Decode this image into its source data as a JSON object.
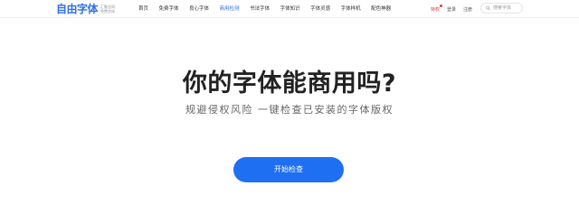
{
  "logo": {
    "text": "自由字体",
    "sub_line1": "汇聚全网",
    "sub_line2": "免费字体"
  },
  "nav": {
    "items": [
      {
        "label": "首页"
      },
      {
        "label": "免费字体"
      },
      {
        "label": "良心字体"
      },
      {
        "label": "商用检测",
        "active": true
      },
      {
        "label": "书法字体"
      },
      {
        "label": "字体知识"
      },
      {
        "label": "字体灵感"
      },
      {
        "label": "字体样机"
      },
      {
        "label": "配色神器"
      }
    ]
  },
  "user": {
    "vip": "特权",
    "login": "登录",
    "register": "注册"
  },
  "search": {
    "placeholder": "搜索字体"
  },
  "hero": {
    "title": "你的字体能商用吗?",
    "subtitle": "规避侵权风险 一键检查已安装的字体版权",
    "button_label": "开始检查"
  },
  "colors": {
    "accent": "#2f6fe6",
    "button": "#1f6ff2",
    "vip": "#e53c3c"
  }
}
